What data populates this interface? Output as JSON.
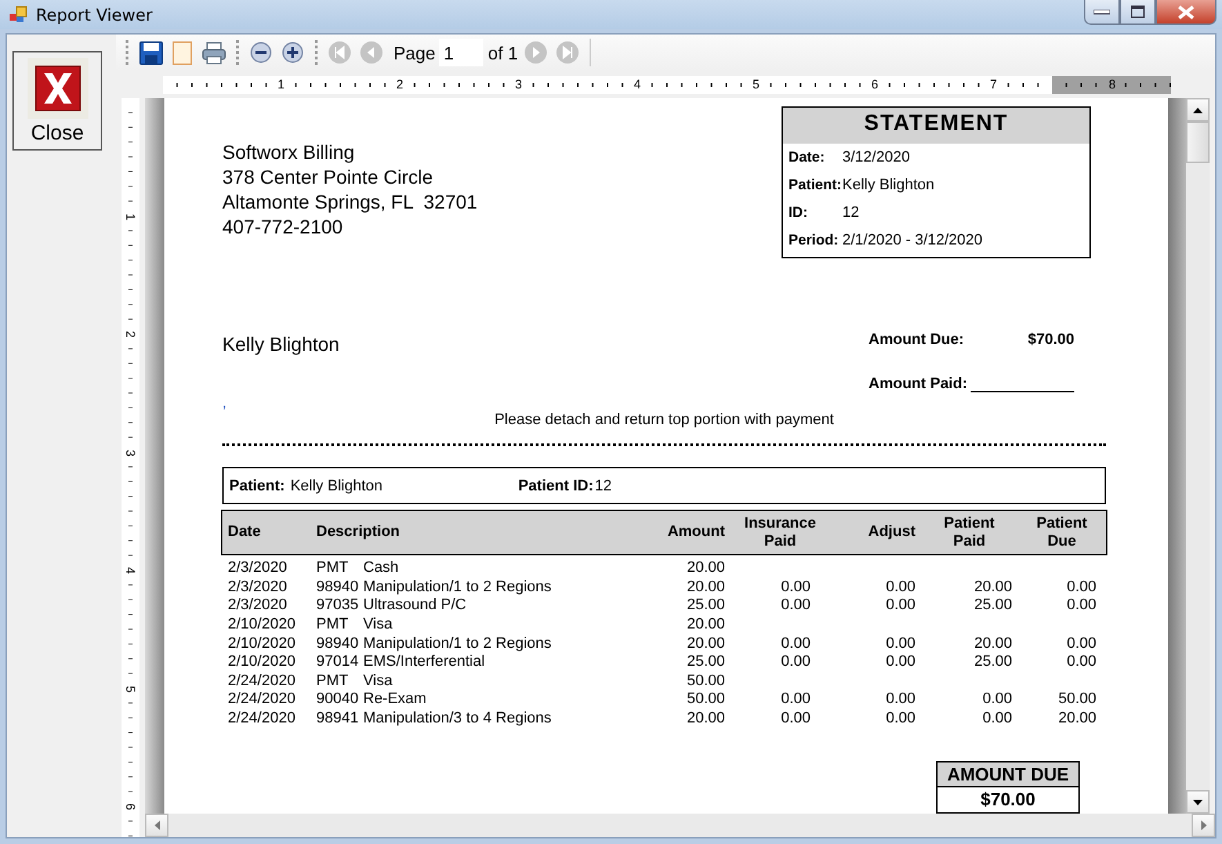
{
  "window": {
    "title": "Report Viewer"
  },
  "sidebar": {
    "close_button": {
      "label": "Close"
    }
  },
  "toolbar": {
    "page_label": "Page",
    "page_value": "1",
    "page_count": "of 1",
    "nav": [
      {
        "kind": "first",
        "disabled": true
      },
      {
        "kind": "prev",
        "disabled": true
      },
      {
        "kind": "next",
        "disabled": true
      },
      {
        "kind": "last",
        "disabled": true
      }
    ]
  },
  "horizontal_ruler": [
    "1",
    "2",
    "3",
    "4",
    "5",
    "6",
    "7",
    "8"
  ],
  "vertical_ruler": [
    "1",
    "2",
    "3",
    "4",
    "5",
    "6"
  ],
  "report": {
    "company": [
      "Softworx Billing",
      "378 Center Pointe Circle",
      "Altamonte Springs, FL  32701",
      "407-772-2100"
    ],
    "statement": {
      "title": "STATEMENT",
      "fields": [
        {
          "label": "Date:",
          "value": "3/12/2020"
        },
        {
          "label": "Patient:",
          "value": "Kelly Blighton"
        },
        {
          "label": "ID:",
          "value": "12"
        },
        {
          "label": "Period:",
          "value": "2/1/2020 - 3/12/2020"
        }
      ]
    },
    "recipient": "Kelly Blighton",
    "amount_due": {
      "label": "Amount Due:",
      "value": "$70.00"
    },
    "amount_paid": {
      "label": "Amount Paid:"
    },
    "stray_mark": ",",
    "detach_note": "Please detach and return top portion with payment",
    "patient_bar": {
      "patient_label": "Patient:",
      "patient": "Kelly Blighton",
      "id_label": "Patient ID:",
      "id": "12"
    },
    "table": {
      "columns": [
        "Date",
        "Description",
        "Amount",
        "Insurance Paid",
        "Adjust",
        "Patient Paid",
        "Patient Due"
      ],
      "rows": [
        {
          "date": "2/3/2020",
          "code": "PMT",
          "description": "Cash",
          "amount": "20.00"
        },
        {
          "date": "2/3/2020",
          "code": "98940",
          "description": "Manipulation/1 to 2 Regions",
          "amount": "20.00",
          "insurance_paid": "0.00",
          "adjust": "0.00",
          "patient_paid": "20.00",
          "patient_due": "0.00"
        },
        {
          "date": "2/3/2020",
          "code": "97035",
          "description": "Ultrasound P/C",
          "amount": "25.00",
          "insurance_paid": "0.00",
          "adjust": "0.00",
          "patient_paid": "25.00",
          "patient_due": "0.00"
        },
        {
          "date": "2/10/2020",
          "code": "PMT",
          "description": "Visa",
          "amount": "20.00"
        },
        {
          "date": "2/10/2020",
          "code": "98940",
          "description": "Manipulation/1 to 2 Regions",
          "amount": "20.00",
          "insurance_paid": "0.00",
          "adjust": "0.00",
          "patient_paid": "20.00",
          "patient_due": "0.00"
        },
        {
          "date": "2/10/2020",
          "code": "97014",
          "description": "EMS/Interferential",
          "amount": "25.00",
          "insurance_paid": "0.00",
          "adjust": "0.00",
          "patient_paid": "25.00",
          "patient_due": "0.00"
        },
        {
          "date": "2/24/2020",
          "code": "PMT",
          "description": "Visa",
          "amount": "50.00"
        },
        {
          "date": "2/24/2020",
          "code": "90040",
          "description": "Re-Exam",
          "amount": "50.00",
          "insurance_paid": "0.00",
          "adjust": "0.00",
          "patient_paid": "0.00",
          "patient_due": "50.00"
        },
        {
          "date": "2/24/2020",
          "code": "98941",
          "description": "Manipulation/3 to 4 Regions",
          "amount": "20.00",
          "insurance_paid": "0.00",
          "adjust": "0.00",
          "patient_paid": "0.00",
          "patient_due": "20.00"
        }
      ]
    },
    "total_box": {
      "label": "AMOUNT DUE",
      "value": "$70.00"
    }
  }
}
